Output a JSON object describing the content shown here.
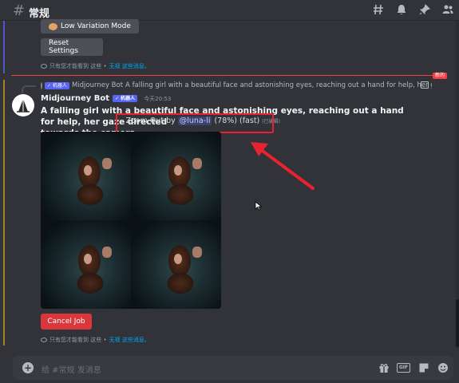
{
  "header": {
    "channel": "常规"
  },
  "top_buttons": {
    "low_variation": "Low Variation Mode",
    "reset": "Reset Settings"
  },
  "ephemeral": {
    "text": "只有您才能看到 这些 •",
    "dismiss": "无视 这些消息。",
    "text2": "只有您才能看到 这些 •",
    "dismiss2": "无视 这些消息。"
  },
  "divider": {
    "new_label": "新的"
  },
  "reply": {
    "bot_tag": "✓ 机器人",
    "author": "Midjourney Bot",
    "preview": "A falling girl with a beautiful face and astonishing eyes, reaching out a hand for help, her g"
  },
  "message": {
    "author": "Midjourney Bot",
    "bot_tag": "✓ 机器人",
    "timestamp": "今天20:53",
    "prompt_line1": "A falling girl with a beautiful face and astonishing eyes, reaching out a hand for help, her gaze directed",
    "prompt_line2": "towards the camera",
    "zoom_prefix": "- Zoom Out by",
    "mention": "@luna-li",
    "progress": "(78%)",
    "speed": "(fast)",
    "edited": "(已编辑)"
  },
  "cancel_button": "Cancel Job",
  "input": {
    "placeholder": "给 #常规 发消息"
  },
  "colors": {
    "accent": "#5865f2",
    "danger": "#da373c",
    "annotation": "#e8232f"
  }
}
